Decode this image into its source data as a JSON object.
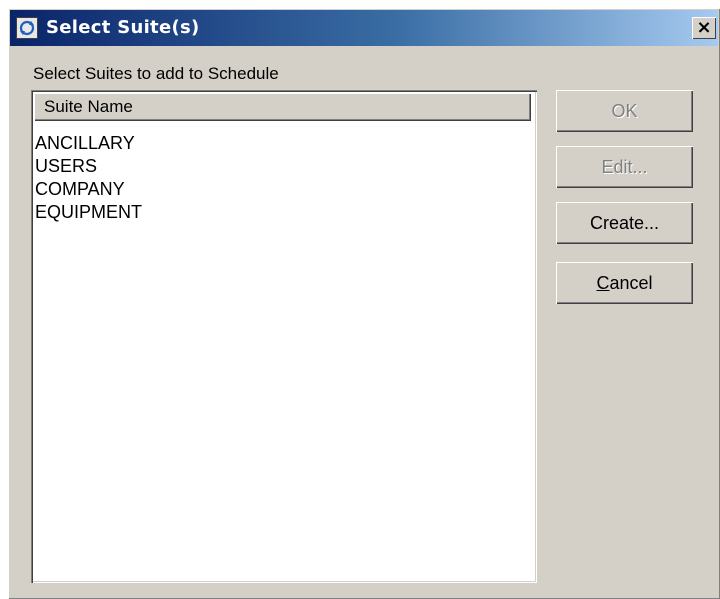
{
  "window": {
    "title": "Select Suite(s)",
    "close_glyph": "×"
  },
  "instruction": "Select Suites to add to Schedule",
  "list": {
    "column_header": "Suite Name",
    "items": [
      "ANCILLARY",
      "USERS",
      "COMPANY",
      "EQUIPMENT"
    ]
  },
  "buttons": {
    "ok": "OK",
    "edit": "Edit...",
    "create": "Create...",
    "cancel_first": "C",
    "cancel_rest": "ancel"
  },
  "colors": {
    "titlebar_start": "#0a246a",
    "titlebar_end": "#a6caf0",
    "face": "#d4d0c8"
  },
  "icons": {
    "title": "app-refresh-icon",
    "close": "close-icon"
  }
}
